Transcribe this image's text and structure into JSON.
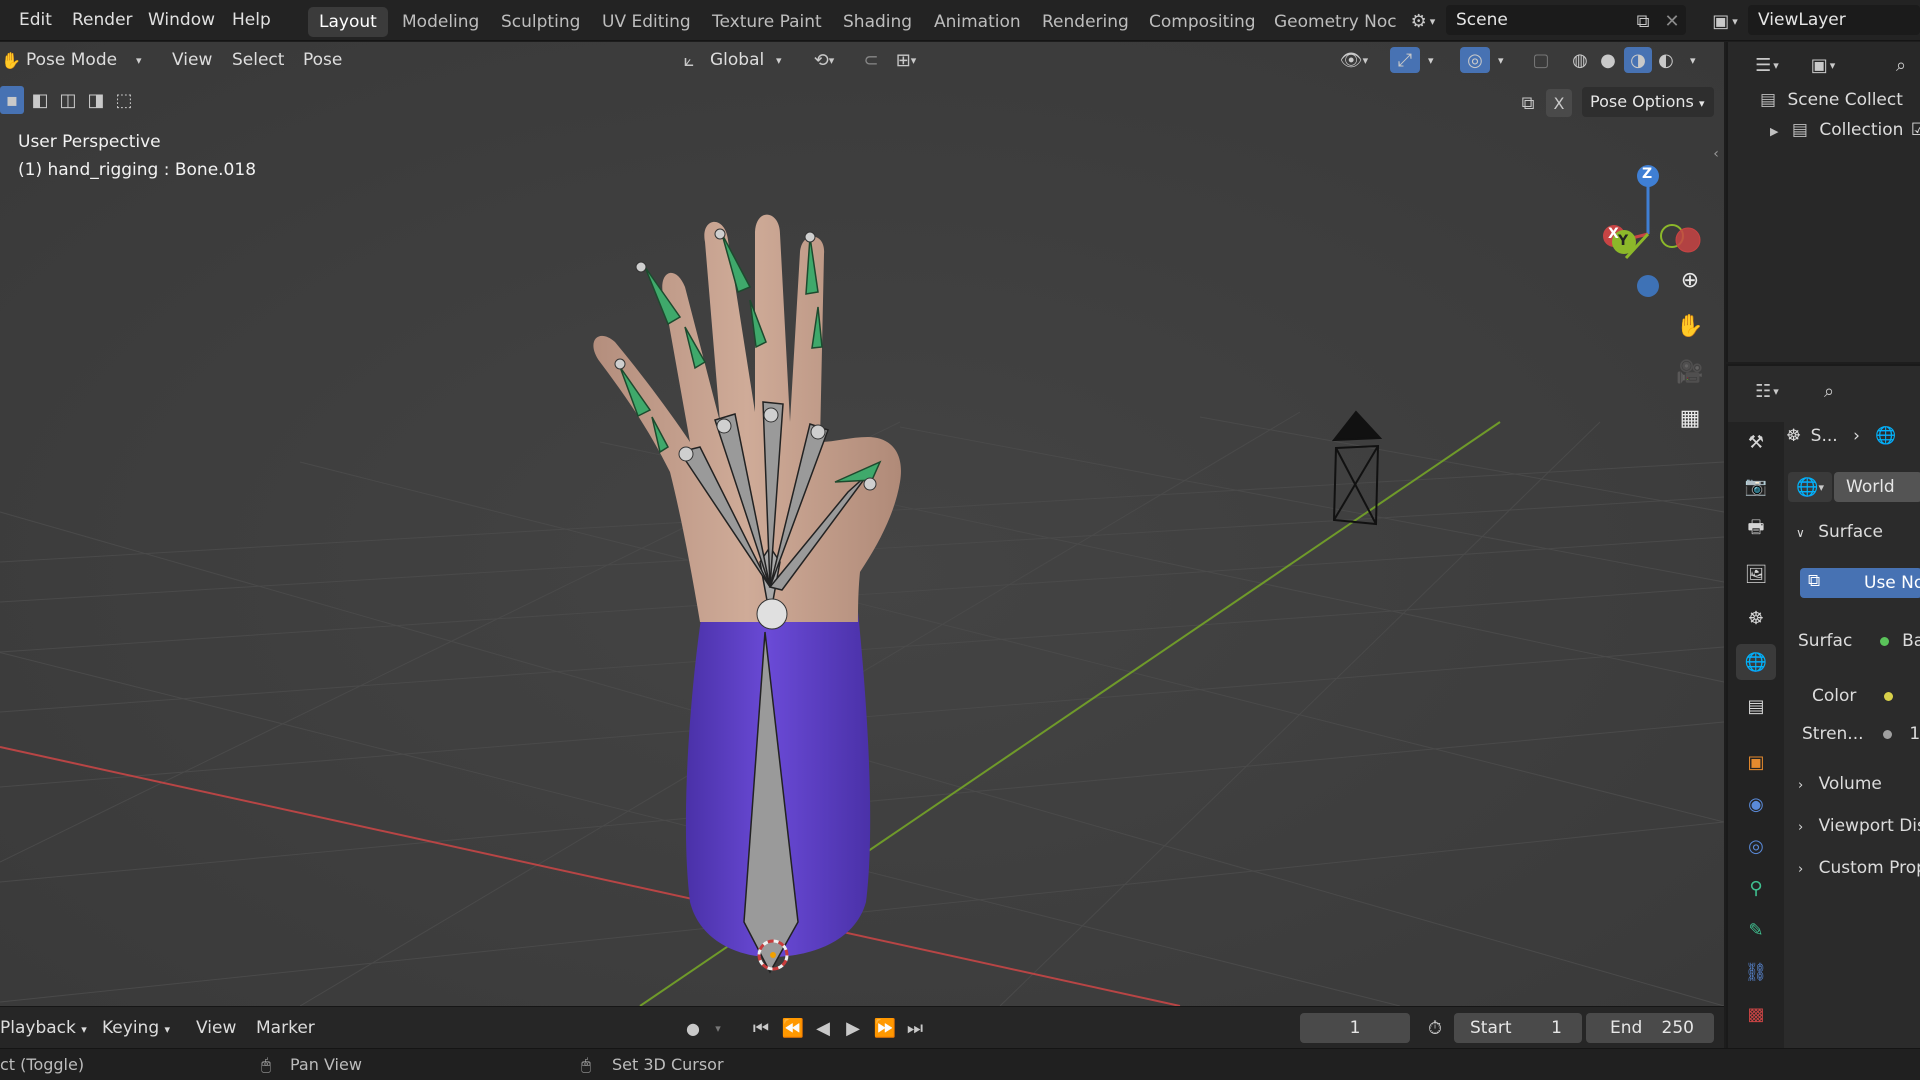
{
  "menu": {
    "edit": "Edit",
    "render": "Render",
    "window": "Window",
    "help": "Help"
  },
  "workspaces": [
    "Layout",
    "Modeling",
    "Sculpting",
    "UV Editing",
    "Texture Paint",
    "Shading",
    "Animation",
    "Rendering",
    "Compositing",
    "Geometry Noc"
  ],
  "scene": {
    "name": "Scene"
  },
  "viewlayer": {
    "name": "ViewLayer"
  },
  "viewport_header": {
    "mode": "Pose Mode",
    "view": "View",
    "select": "Select",
    "pose": "Pose",
    "orientation": "Global",
    "pose_options": "Pose Options",
    "x_toggle": "X"
  },
  "overlay": {
    "perspective": "User Perspective",
    "active_bone": "(1) hand_rigging : Bone.018"
  },
  "gizmo": {
    "z": "Z",
    "x": "X",
    "y": "Y"
  },
  "outliner": {
    "scene_collection": "Scene Collect",
    "collection": "Collection"
  },
  "properties": {
    "breadcrumb": "S...",
    "world_name": "World",
    "surface_panel": "Surface",
    "use_nodes": "Use Noc",
    "surface_label": "Surfac",
    "surface_value": "Bac",
    "color_label": "Color",
    "strength_label": "Stren...",
    "strength_value": "1",
    "volume_panel": "Volume",
    "viewport_display_panel": "Viewport Disp",
    "custom_props_panel": "Custom Prope"
  },
  "timeline": {
    "playback": "Playback",
    "keying": "Keying",
    "view": "View",
    "marker": "Marker",
    "current_frame": "1",
    "start_label": "Start",
    "start_value": "1",
    "end_label": "End",
    "end_value": "250"
  },
  "statusbar": {
    "left": "ct (Toggle)",
    "pan": "Pan View",
    "cursor": "Set 3D Cursor"
  },
  "colors": {
    "accent_blue": "#4772b3",
    "skin": "#c7a290",
    "sleeve": "#5a3ec2",
    "bone_tip": "#3fa96b",
    "axis_red": "#b84545",
    "axis_green": "#6f9a2a"
  }
}
